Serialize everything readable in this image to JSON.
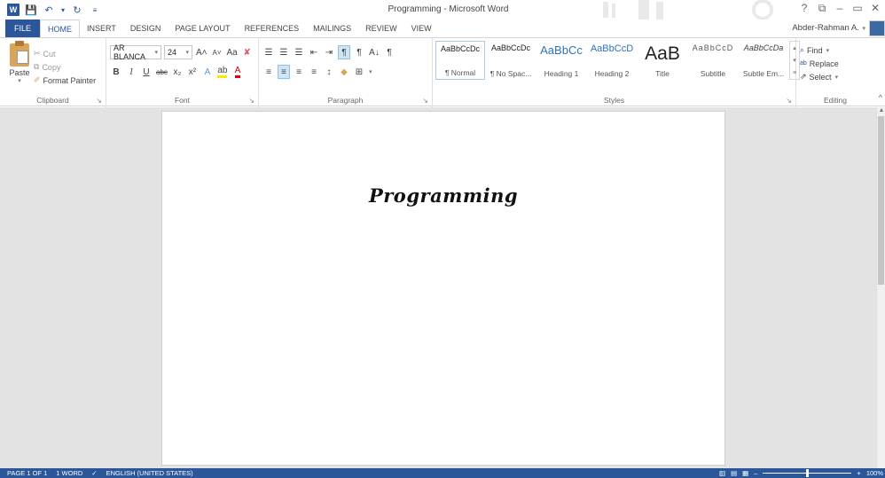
{
  "window": {
    "title": "Programming - Microsoft Word",
    "help": "?",
    "controls": [
      "⧉",
      "–",
      "▭",
      "✕"
    ]
  },
  "quick_access": {
    "app_icon": "W",
    "save": "💾",
    "undo": "↶",
    "undo_caret": "▾",
    "redo": "↻",
    "customize": "≡"
  },
  "tabs": [
    {
      "label": "FILE"
    },
    {
      "label": "HOME"
    },
    {
      "label": "INSERT"
    },
    {
      "label": "DESIGN"
    },
    {
      "label": "PAGE LAYOUT"
    },
    {
      "label": "REFERENCES"
    },
    {
      "label": "MAILINGS"
    },
    {
      "label": "REVIEW"
    },
    {
      "label": "VIEW"
    }
  ],
  "user": {
    "name": "Abder-Rahman A.",
    "caret": "▾"
  },
  "clipboard": {
    "label": "Clipboard",
    "launcher": "↘",
    "paste": "Paste",
    "paste_caret": "▾",
    "cut": "Cut",
    "copy": "Copy",
    "format_painter": "Format Painter"
  },
  "font": {
    "label": "Font",
    "launcher": "↘",
    "name": "AR BLANCA",
    "size": "24",
    "caret": "▾",
    "grow": "A˄",
    "shrink": "A˅",
    "case": "Aa",
    "clear": "✘",
    "bold": "B",
    "italic": "I",
    "underline": "U",
    "strike": "abc",
    "subscript": "x₂",
    "superscript": "x²",
    "effects": "A",
    "highlight": "ab",
    "color": "A"
  },
  "paragraph": {
    "label": "Paragraph",
    "launcher": "↘",
    "bullets": "☰",
    "numbering": "☰",
    "multilevel": "☰",
    "decrease_indent": "⇤",
    "increase_indent": "⇥",
    "ltr": "¶",
    "rtl": "¶",
    "sort": "A↓",
    "show_marks": "¶",
    "align_left": "≡",
    "align_center": "≡",
    "align_right": "≡",
    "justify": "≡",
    "line_spacing": "↕",
    "shading": "◆",
    "borders": "⊞",
    "caret": "▾"
  },
  "styles": {
    "label": "Styles",
    "launcher": "↘",
    "scroll_up": "▴",
    "scroll_down": "▾",
    "more": "≡",
    "items": [
      {
        "preview": "AaBbCcDc",
        "name": "¶ Normal",
        "preview_color": "#222222",
        "preview_size": "9px"
      },
      {
        "preview": "AaBbCcDc",
        "name": "¶ No Spac...",
        "preview_color": "#222222",
        "preview_size": "9px"
      },
      {
        "preview": "AaBbCc",
        "name": "Heading 1",
        "preview_color": "#2e74b5",
        "preview_size": "13px"
      },
      {
        "preview": "AaBbCcD",
        "name": "Heading 2",
        "preview_color": "#2e74b5",
        "preview_size": "11px"
      },
      {
        "preview": "AaB",
        "name": "Title",
        "preview_color": "#222222",
        "preview_size": "21px"
      },
      {
        "preview": "AaBbCcD",
        "name": "Subtitle",
        "preview_color": "#595959",
        "preview_size": "9px"
      },
      {
        "preview": "AaBbCcDa",
        "name": "Subtle Em...",
        "preview_color": "#404040",
        "preview_size": "9px"
      }
    ]
  },
  "editing": {
    "label": "Editing",
    "find": "Find",
    "find_caret": "▾",
    "replace": "Replace",
    "select": "Select",
    "select_caret": "▾",
    "find_icon": "⌕",
    "replace_icon": "ab",
    "select_icon": "⇗"
  },
  "ribbon_collapse": "^",
  "document": {
    "text": "Programming"
  },
  "statusbar": {
    "page": "PAGE 1 OF 1",
    "words": "1 WORD",
    "proof_icon": "✓",
    "language": "ENGLISH (UNITED STATES)",
    "read_mode": "▥",
    "print_layout": "▤",
    "web_layout": "▦",
    "zoom_out": "–",
    "zoom_in": "+",
    "zoom": "100%",
    "zoom_value": 0.5
  },
  "colors": {
    "accent": "#2b579a",
    "highlight": "#ffe800",
    "font_color": "#e00000"
  }
}
